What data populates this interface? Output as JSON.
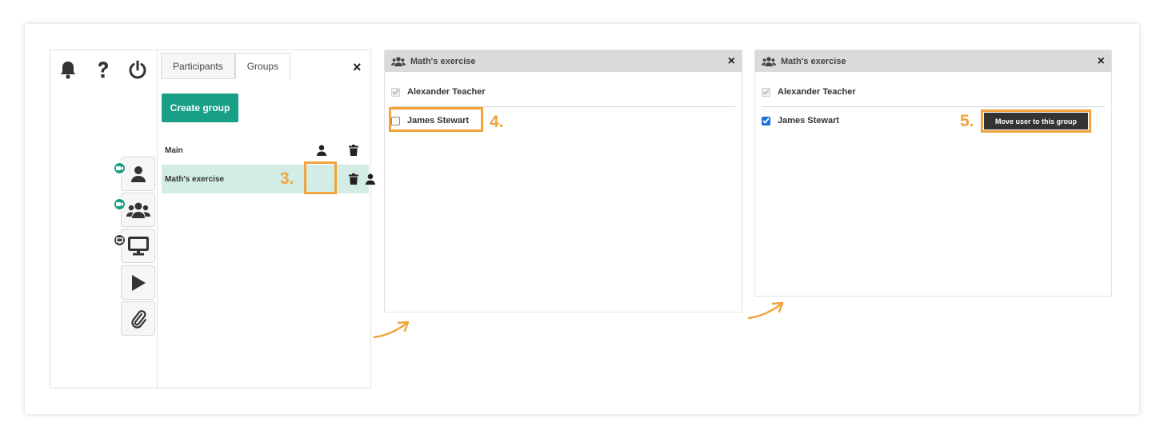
{
  "panel1": {
    "tabs": [
      "Participants",
      "Groups"
    ],
    "close": "×",
    "create_group_label": "Create group",
    "groups": [
      {
        "name": "Main"
      },
      {
        "name": "Math's exercise"
      }
    ]
  },
  "panel2": {
    "title": "Math's exercise",
    "close": "×",
    "users": [
      {
        "name": "Alexander Teacher"
      },
      {
        "name": "James Stewart"
      }
    ]
  },
  "panel3": {
    "title": "Math's exercise",
    "close": "×",
    "users": [
      {
        "name": "Alexander Teacher"
      },
      {
        "name": "James Stewart"
      }
    ],
    "move_button_label": "Move user to this group"
  },
  "steps": [
    "3.",
    "4.",
    "5."
  ],
  "colors": {
    "accent": "#17a086",
    "highlight": "#f0a43a",
    "selected_row": "#d3ece6",
    "checkbox": "#1d6fe0"
  }
}
